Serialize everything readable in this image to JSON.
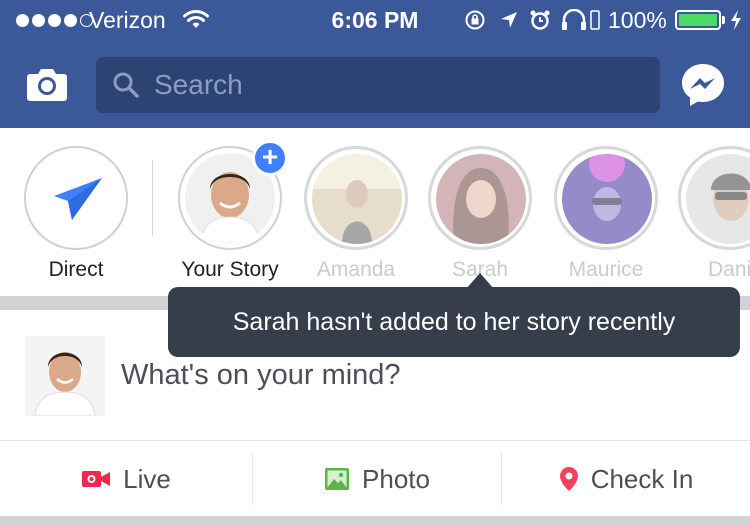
{
  "status_bar": {
    "carrier": "Verizon",
    "time": "6:06 PM",
    "battery_percent": "100%",
    "battery_level": 1.0,
    "signal_bars": 4,
    "icons": [
      "wifi-icon",
      "orientation-lock-icon",
      "location-icon",
      "alarm-icon",
      "headphones-icon",
      "battery-icon",
      "charging-icon"
    ]
  },
  "header": {
    "search_placeholder": "Search",
    "icons": [
      "camera-icon",
      "search-icon",
      "messenger-icon"
    ]
  },
  "stories": {
    "items": [
      {
        "label": "Direct",
        "kind": "direct",
        "icon": "paper-plane-icon"
      },
      {
        "label": "Your Story",
        "kind": "own",
        "badge": "+"
      },
      {
        "label": "Amanda",
        "kind": "friend",
        "seen": true
      },
      {
        "label": "Sarah",
        "kind": "friend",
        "seen": true
      },
      {
        "label": "Maurice",
        "kind": "friend",
        "seen": true
      },
      {
        "label": "Danie",
        "kind": "friend",
        "seen": true
      }
    ]
  },
  "tooltip": {
    "text": "Sarah hasn't added to her story recently"
  },
  "composer": {
    "placeholder": "What's on your mind?"
  },
  "actions": {
    "live": "Live",
    "photo": "Photo",
    "check_in": "Check In"
  },
  "colors": {
    "brand_blue": "#3b5998",
    "search_bar": "#2c4373",
    "accent_blue": "#4080ff",
    "live_red": "#f02849",
    "photo_green": "#5db54a",
    "checkin_pink": "#f3425f",
    "tooltip_bg": "#363d4b"
  }
}
